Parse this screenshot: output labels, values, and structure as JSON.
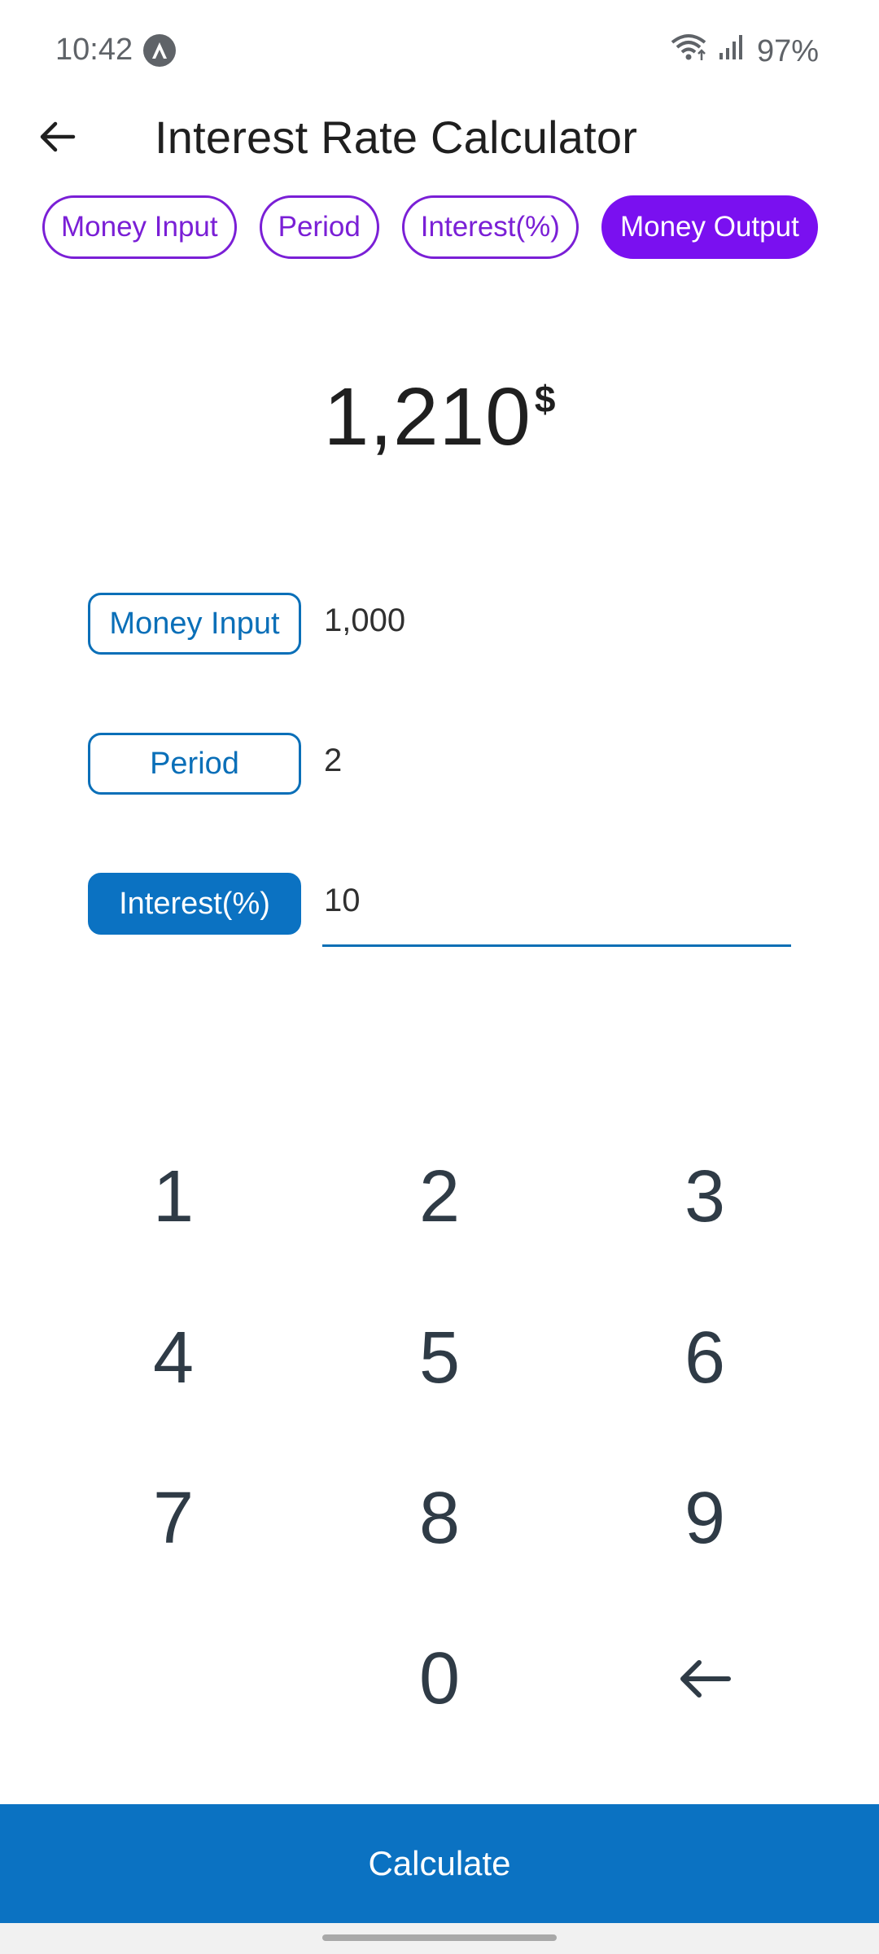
{
  "status_bar": {
    "time": "10:42",
    "battery": "97%",
    "icons": [
      "app-notification-icon",
      "wifi-icon",
      "signal-icon"
    ]
  },
  "header": {
    "title": "Interest Rate Calculator",
    "back_icon": "arrow-left-icon"
  },
  "mode_chips": [
    {
      "label": "Money Input",
      "selected": false
    },
    {
      "label": "Period",
      "selected": false
    },
    {
      "label": "Interest(%)",
      "selected": false
    },
    {
      "label": "Money Output",
      "selected": true
    }
  ],
  "result": {
    "value": "1,210",
    "unit": "$"
  },
  "fields": [
    {
      "label": "Money Input",
      "value": "1,000",
      "active": false
    },
    {
      "label": "Period",
      "value": "2",
      "active": false
    },
    {
      "label": "Interest(%)",
      "value": "10",
      "active": true
    }
  ],
  "keypad": {
    "keys": [
      "1",
      "2",
      "3",
      "4",
      "5",
      "6",
      "7",
      "8",
      "9",
      "0"
    ],
    "backspace_icon": "backspace-arrow-icon"
  },
  "calculate_label": "Calculate",
  "colors": {
    "chip_accent": "#7a10f0",
    "field_accent": "#0b72c2",
    "button_bg": "#0b72c2"
  }
}
